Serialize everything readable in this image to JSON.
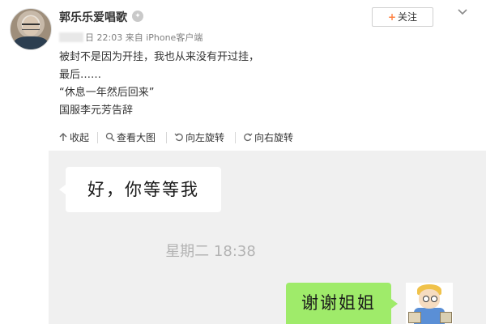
{
  "post": {
    "username": "郭乐乐爱唱歌",
    "follow_label": "关注",
    "timestamp": "日 22:03",
    "source": "来自 iPhone客户端",
    "lines": [
      "被封不是因为开挂，我也从来没有开过挂，",
      "最后……",
      "“休息一年然后回来”",
      "国服李元芳告辞"
    ]
  },
  "toolbar": {
    "items": [
      {
        "label": "收起",
        "icon": "collapse-arrow-icon"
      },
      {
        "label": "查看大图",
        "icon": "magnify-icon"
      },
      {
        "label": "向左旋转",
        "icon": "rotate-left-icon"
      },
      {
        "label": "向右旋转",
        "icon": "rotate-right-icon"
      }
    ]
  },
  "chat": {
    "incoming_message": "好，你等等我",
    "time_divider": "星期二 18:38",
    "outgoing_message": "谢谢姐姐"
  },
  "colors": {
    "accent_follow": "#ff8140",
    "outgoing_bubble": "#9feb6a",
    "chat_background": "#f0f0f0"
  }
}
